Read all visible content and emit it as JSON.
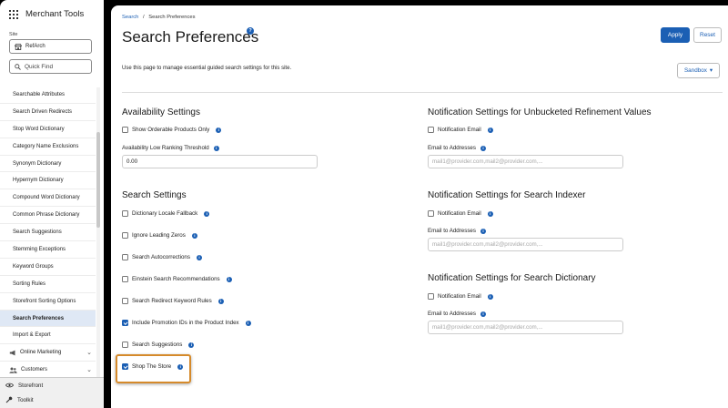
{
  "app": {
    "title": "Merchant Tools"
  },
  "site": {
    "label": "Site",
    "value": "RefArch"
  },
  "quickfind": {
    "placeholder": "Quick Find"
  },
  "nav": {
    "items": [
      {
        "label": "Searchable Attributes"
      },
      {
        "label": "Search Driven Redirects"
      },
      {
        "label": "Stop Word Dictionary"
      },
      {
        "label": "Category Name Exclusions"
      },
      {
        "label": "Synonym Dictionary"
      },
      {
        "label": "Hypernym Dictionary"
      },
      {
        "label": "Compound Word Dictionary"
      },
      {
        "label": "Common Phrase Dictionary"
      },
      {
        "label": "Search Suggestions"
      },
      {
        "label": "Stemming Exceptions"
      },
      {
        "label": "Keyword Groups"
      },
      {
        "label": "Sorting Rules"
      },
      {
        "label": "Storefront Sorting Options"
      },
      {
        "label": "Search Preferences",
        "active": true
      },
      {
        "label": "Import & Export"
      }
    ],
    "groups": [
      {
        "label": "Online Marketing"
      },
      {
        "label": "Customers"
      }
    ],
    "footer": [
      {
        "label": "Storefront"
      },
      {
        "label": "Toolkit"
      }
    ]
  },
  "breadcrumb": {
    "parent": "Search",
    "separator": "/",
    "current": "Search Preferences"
  },
  "page": {
    "title": "Search Preferences",
    "help": "?",
    "description": "Use this page to manage essential guided search settings for this site."
  },
  "toolbar": {
    "apply": "Apply",
    "reset": "Reset",
    "sandbox": "Sandbox",
    "sandbox_caret": "▾"
  },
  "availability": {
    "title": "Availability Settings",
    "show_orderable": {
      "label": "Show Orderable Products Only",
      "checked": false
    },
    "threshold": {
      "label": "Availability Low Ranking Threshold",
      "value": "0.00"
    }
  },
  "search_settings": {
    "title": "Search Settings",
    "options": [
      {
        "label": "Dictionary Locale Fallback",
        "checked": false
      },
      {
        "label": "Ignore Leading Zeros",
        "checked": false
      },
      {
        "label": "Search Autocorrections",
        "checked": false
      },
      {
        "label": "Einstein Search Recommendations",
        "checked": false
      },
      {
        "label": "Search Redirect Keyword Rules",
        "checked": false
      },
      {
        "label": "Include Promotion IDs in the Product Index",
        "checked": true
      },
      {
        "label": "Search Suggestions",
        "checked": false
      },
      {
        "label": "Shop The Store",
        "checked": true
      }
    ]
  },
  "notifications": [
    {
      "title": "Notification Settings for Unbucketed Refinement Values",
      "email_label": "Notification Email",
      "addresses_label": "Email to Addresses",
      "placeholder": "mail1@provider.com,mail2@provider.com,..."
    },
    {
      "title": "Notification Settings for Search Indexer",
      "email_label": "Notification Email",
      "addresses_label": "Email to Addresses",
      "placeholder": "mail1@provider.com,mail2@provider.com,..."
    },
    {
      "title": "Notification Settings for Search Dictionary",
      "email_label": "Notification Email",
      "addresses_label": "Email to Addresses",
      "placeholder": "mail1@provider.com,mail2@provider.com,..."
    }
  ],
  "info_glyph": "i",
  "colors": {
    "accent": "#1b5fb4",
    "highlight": "#d58a2b",
    "active_nav": "#dfe8f5"
  }
}
